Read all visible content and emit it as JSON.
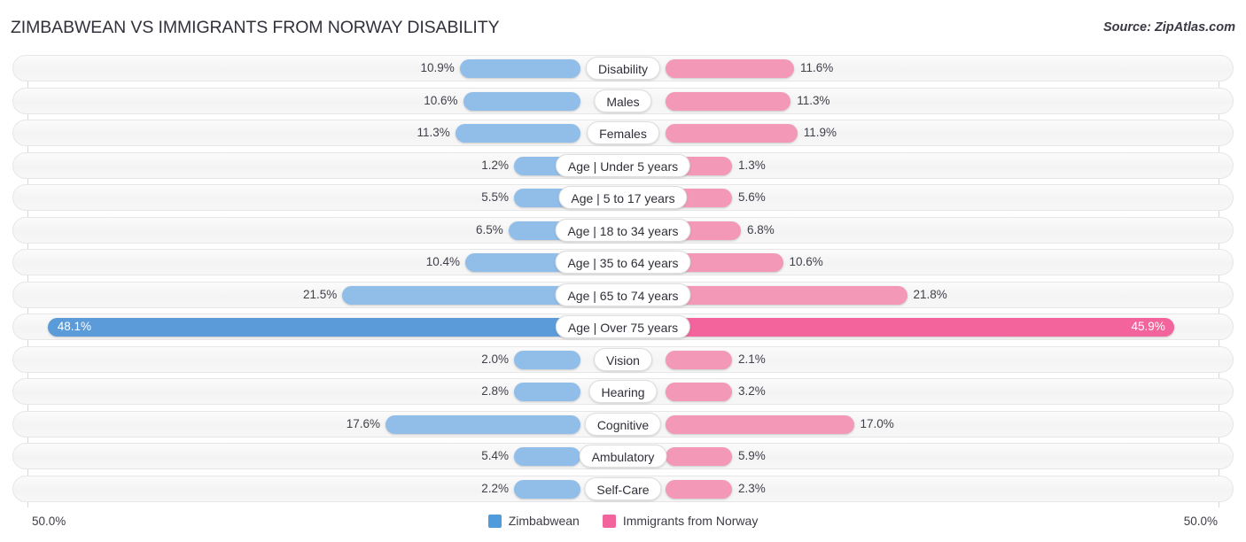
{
  "header": {
    "title": "ZIMBABWEAN VS IMMIGRANTS FROM NORWAY DISABILITY",
    "source": "Source: ZipAtlas.com"
  },
  "axis": {
    "left_tick": "50.0%",
    "right_tick": "50.0%",
    "max": 50.0
  },
  "legend": {
    "items": [
      {
        "label": "Zimbabwean",
        "color": "#4f9bdc"
      },
      {
        "label": "Immigrants from Norway",
        "color": "#f2649b"
      }
    ]
  },
  "colors": {
    "left_bar": "#90bee9",
    "right_bar": "#f498b8",
    "left_bar_max": "#5b9bd9",
    "right_bar_max": "#f2649b",
    "row_track": "#f5f5f5"
  },
  "chart_data": {
    "type": "bar",
    "title": "ZIMBABWEAN VS IMMIGRANTS FROM NORWAY DISABILITY",
    "subtitle": "Source: ZipAtlas.com",
    "orientation": "horizontal-diverging",
    "xlabel": "",
    "ylabel": "",
    "xlim": [
      50.0,
      50.0
    ],
    "grid": false,
    "legend_position": "bottom-center",
    "categories": [
      "Disability",
      "Males",
      "Females",
      "Age | Under 5 years",
      "Age | 5 to 17 years",
      "Age | 18 to 34 years",
      "Age | 35 to 64 years",
      "Age | 65 to 74 years",
      "Age | Over 75 years",
      "Vision",
      "Hearing",
      "Cognitive",
      "Ambulatory",
      "Self-Care"
    ],
    "series": [
      {
        "name": "Zimbabwean",
        "values": [
          10.9,
          10.6,
          11.3,
          1.2,
          5.5,
          6.5,
          10.4,
          21.5,
          48.1,
          2.0,
          2.8,
          17.6,
          5.4,
          2.2
        ]
      },
      {
        "name": "Immigrants from Norway",
        "values": [
          11.6,
          11.3,
          11.9,
          1.3,
          5.6,
          6.8,
          10.6,
          21.8,
          45.9,
          2.1,
          3.2,
          17.0,
          5.9,
          2.3
        ]
      }
    ]
  },
  "rows": [
    {
      "label": "Disability",
      "left": "10.9%",
      "right": "11.6%",
      "left_val": 10.9,
      "right_val": 11.6,
      "max": false
    },
    {
      "label": "Males",
      "left": "10.6%",
      "right": "11.3%",
      "left_val": 10.6,
      "right_val": 11.3,
      "max": false
    },
    {
      "label": "Females",
      "left": "11.3%",
      "right": "11.9%",
      "left_val": 11.3,
      "right_val": 11.9,
      "max": false
    },
    {
      "label": "Age | Under 5 years",
      "left": "1.2%",
      "right": "1.3%",
      "left_val": 1.2,
      "right_val": 1.3,
      "max": false
    },
    {
      "label": "Age | 5 to 17 years",
      "left": "5.5%",
      "right": "5.6%",
      "left_val": 5.5,
      "right_val": 5.6,
      "max": false
    },
    {
      "label": "Age | 18 to 34 years",
      "left": "6.5%",
      "right": "6.8%",
      "left_val": 6.5,
      "right_val": 6.8,
      "max": false
    },
    {
      "label": "Age | 35 to 64 years",
      "left": "10.4%",
      "right": "10.6%",
      "left_val": 10.4,
      "right_val": 10.6,
      "max": false
    },
    {
      "label": "Age | 65 to 74 years",
      "left": "21.5%",
      "right": "21.8%",
      "left_val": 21.5,
      "right_val": 21.8,
      "max": false
    },
    {
      "label": "Age | Over 75 years",
      "left": "48.1%",
      "right": "45.9%",
      "left_val": 48.1,
      "right_val": 45.9,
      "max": true
    },
    {
      "label": "Vision",
      "left": "2.0%",
      "right": "2.1%",
      "left_val": 2.0,
      "right_val": 2.1,
      "max": false
    },
    {
      "label": "Hearing",
      "left": "2.8%",
      "right": "3.2%",
      "left_val": 2.8,
      "right_val": 3.2,
      "max": false
    },
    {
      "label": "Cognitive",
      "left": "17.6%",
      "right": "17.0%",
      "left_val": 17.6,
      "right_val": 17.0,
      "max": false
    },
    {
      "label": "Ambulatory",
      "left": "5.4%",
      "right": "5.9%",
      "left_val": 5.4,
      "right_val": 5.9,
      "max": false
    },
    {
      "label": "Self-Care",
      "left": "2.2%",
      "right": "2.3%",
      "left_val": 2.2,
      "right_val": 2.3,
      "max": false
    }
  ]
}
